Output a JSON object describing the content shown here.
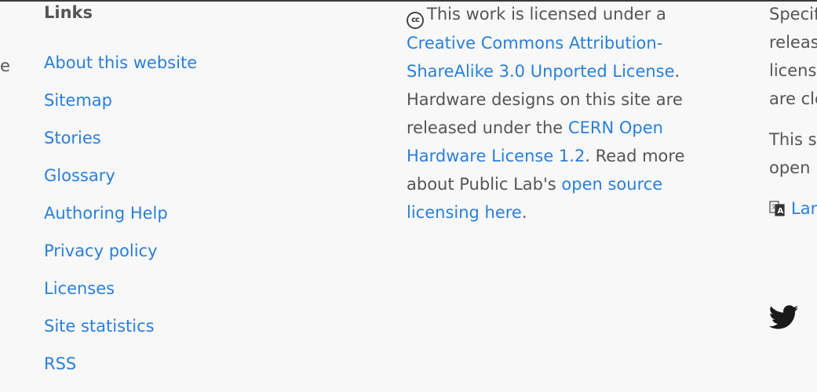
{
  "left_edge_text": "e",
  "links": {
    "heading": "Links",
    "items": [
      {
        "label": "About this website"
      },
      {
        "label": "Sitemap"
      },
      {
        "label": "Stories"
      },
      {
        "label": "Glossary"
      },
      {
        "label": "Authoring Help"
      },
      {
        "label": "Privacy policy"
      },
      {
        "label": "Licenses"
      },
      {
        "label": "Site statistics"
      },
      {
        "label": "RSS"
      }
    ]
  },
  "license": {
    "cc_icon_text": "cc",
    "text1": "This work is licensed under a",
    "link1": "Creative Commons Attribution-ShareAlike 3.0 Unported License",
    "text2": ". Hardware designs on this site are released under the",
    "link2": "CERN Open Hardware License 1.2",
    "text3": ". Read more about Public Lab's",
    "link3": "open source licensing here",
    "text4": "."
  },
  "right": {
    "para1_lines": [
      "Specif",
      "releas",
      "licens",
      "are cle"
    ],
    "para2_lines": [
      "This s",
      "open"
    ],
    "lang_label": "Lan",
    "lang_icon": "translate-icon",
    "twitter_icon": "twitter-icon"
  },
  "colors": {
    "link": "#2a7fd8",
    "text": "#555555",
    "background": "#f8f8f8"
  }
}
